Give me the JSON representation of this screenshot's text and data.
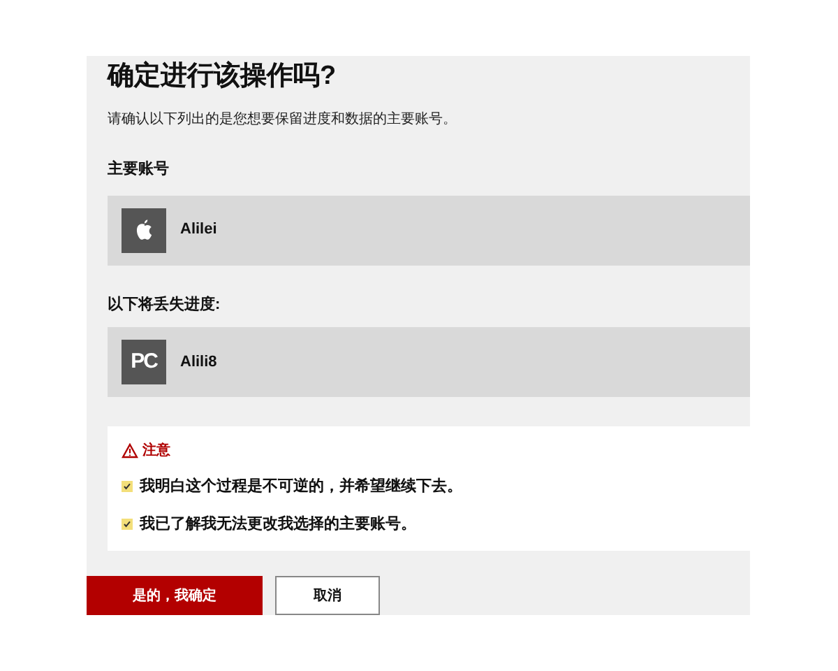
{
  "title": "确定进行该操作吗?",
  "description": "请确认以下列出的是您想要保留进度和数据的主要账号。",
  "primary": {
    "heading": "主要账号",
    "account": {
      "kind": "apple",
      "name": "Alilei"
    }
  },
  "lost": {
    "heading": "以下将丢失进度:",
    "account": {
      "kind": "pc",
      "icon_text": "PC",
      "name": "Alili8"
    }
  },
  "notice": {
    "title": "注意",
    "items": [
      {
        "label": "我明白这个过程是不可逆的，并希望继续下去。",
        "checked": true
      },
      {
        "label": "我已了解我无法更改我选择的主要账号。",
        "checked": true
      }
    ]
  },
  "buttons": [
    {
      "kind": "primary",
      "label": "是的，我确定"
    },
    {
      "kind": "secondary",
      "label": "取消"
    }
  ]
}
